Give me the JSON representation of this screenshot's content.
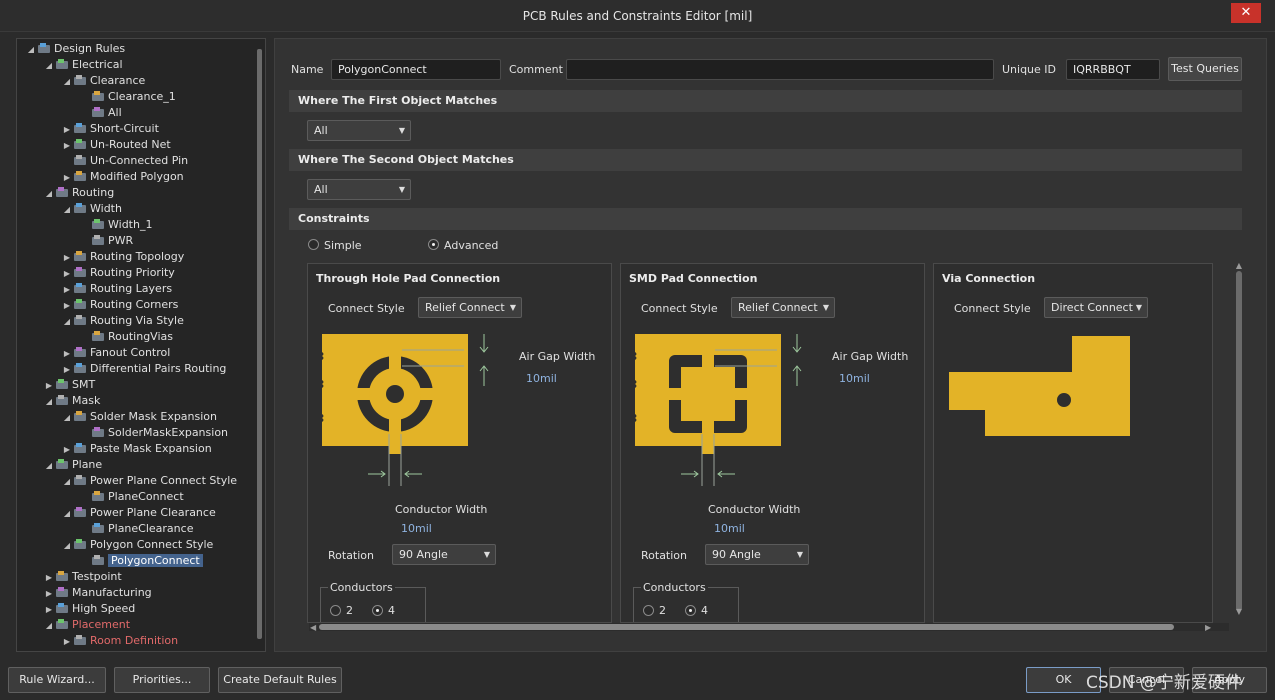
{
  "window": {
    "title": "PCB Rules and Constraints Editor [mil]",
    "close_glyph": "✕"
  },
  "tree": {
    "rows": [
      {
        "label": "Design Rules",
        "level": 0,
        "expander": "◢",
        "icon": "design-rules-icon"
      },
      {
        "label": "Electrical",
        "level": 1,
        "expander": "◢",
        "icon": "electrical-icon"
      },
      {
        "label": "Clearance",
        "level": 2,
        "expander": "◢",
        "icon": "clearance-icon"
      },
      {
        "label": "Clearance_1",
        "level": 3,
        "expander": "",
        "icon": "clearance-rule-icon"
      },
      {
        "label": "All",
        "level": 3,
        "expander": "",
        "icon": "clearance-rule-icon"
      },
      {
        "label": "Short-Circuit",
        "level": 2,
        "expander": "▶",
        "icon": "short-circuit-icon"
      },
      {
        "label": "Un-Routed Net",
        "level": 2,
        "expander": "▶",
        "icon": "unrouted-net-icon"
      },
      {
        "label": "Un-Connected Pin",
        "level": 2,
        "expander": "",
        "icon": "unconnected-pin-icon"
      },
      {
        "label": "Modified Polygon",
        "level": 2,
        "expander": "▶",
        "icon": "modified-polygon-icon"
      },
      {
        "label": "Routing",
        "level": 1,
        "expander": "◢",
        "icon": "routing-icon"
      },
      {
        "label": "Width",
        "level": 2,
        "expander": "◢",
        "icon": "width-icon"
      },
      {
        "label": "Width_1",
        "level": 3,
        "expander": "",
        "icon": "width-rule-icon"
      },
      {
        "label": "PWR",
        "level": 3,
        "expander": "",
        "icon": "width-rule-icon"
      },
      {
        "label": "Routing Topology",
        "level": 2,
        "expander": "▶",
        "icon": "routing-topology-icon"
      },
      {
        "label": "Routing Priority",
        "level": 2,
        "expander": "▶",
        "icon": "routing-priority-icon"
      },
      {
        "label": "Routing Layers",
        "level": 2,
        "expander": "▶",
        "icon": "routing-layers-icon"
      },
      {
        "label": "Routing Corners",
        "level": 2,
        "expander": "▶",
        "icon": "routing-corners-icon"
      },
      {
        "label": "Routing Via Style",
        "level": 2,
        "expander": "◢",
        "icon": "routing-via-style-icon"
      },
      {
        "label": "RoutingVias",
        "level": 3,
        "expander": "",
        "icon": "routing-via-rule-icon"
      },
      {
        "label": "Fanout Control",
        "level": 2,
        "expander": "▶",
        "icon": "fanout-control-icon"
      },
      {
        "label": "Differential Pairs Routing",
        "level": 2,
        "expander": "▶",
        "icon": "diff-pairs-icon"
      },
      {
        "label": "SMT",
        "level": 1,
        "expander": "▶",
        "icon": "smt-icon"
      },
      {
        "label": "Mask",
        "level": 1,
        "expander": "◢",
        "icon": "mask-icon"
      },
      {
        "label": "Solder Mask Expansion",
        "level": 2,
        "expander": "◢",
        "icon": "solder-mask-icon"
      },
      {
        "label": "SolderMaskExpansion",
        "level": 3,
        "expander": "",
        "icon": "solder-mask-rule-icon"
      },
      {
        "label": "Paste Mask Expansion",
        "level": 2,
        "expander": "▶",
        "icon": "paste-mask-icon"
      },
      {
        "label": "Plane",
        "level": 1,
        "expander": "◢",
        "icon": "plane-icon"
      },
      {
        "label": "Power Plane Connect Style",
        "level": 2,
        "expander": "◢",
        "icon": "plane-connect-icon"
      },
      {
        "label": "PlaneConnect",
        "level": 3,
        "expander": "",
        "icon": "plane-connect-rule-icon"
      },
      {
        "label": "Power Plane Clearance",
        "level": 2,
        "expander": "◢",
        "icon": "plane-clearance-icon"
      },
      {
        "label": "PlaneClearance",
        "level": 3,
        "expander": "",
        "icon": "plane-clearance-rule-icon"
      },
      {
        "label": "Polygon Connect Style",
        "level": 2,
        "expander": "◢",
        "icon": "polygon-connect-icon"
      },
      {
        "label": "PolygonConnect",
        "level": 3,
        "expander": "",
        "icon": "polygon-connect-rule-icon",
        "selected": true
      },
      {
        "label": "Testpoint",
        "level": 1,
        "expander": "▶",
        "icon": "testpoint-icon"
      },
      {
        "label": "Manufacturing",
        "level": 1,
        "expander": "▶",
        "icon": "manufacturing-icon"
      },
      {
        "label": "High Speed",
        "level": 1,
        "expander": "▶",
        "icon": "high-speed-icon"
      },
      {
        "label": "Placement",
        "level": 1,
        "expander": "◢",
        "icon": "placement-icon",
        "red": true
      },
      {
        "label": "Room Definition",
        "level": 2,
        "expander": "▶",
        "icon": "room-definition-icon",
        "red": true
      }
    ]
  },
  "header": {
    "name_label": "Name",
    "name_value": "PolygonConnect",
    "comment_label": "Comment",
    "comment_value": "",
    "uid_label": "Unique ID",
    "uid_value": "IQRRBBQT",
    "test_queries": "Test Queries"
  },
  "first_match": {
    "title": "Where The First Object Matches",
    "value": "All"
  },
  "second_match": {
    "title": "Where The Second Object Matches",
    "value": "All"
  },
  "constraints": {
    "title": "Constraints",
    "simple": "Simple",
    "advanced": "Advanced",
    "selected": "advanced"
  },
  "through_hole": {
    "title": "Through Hole Pad Connection",
    "connect_style_label": "Connect Style",
    "connect_style": "Relief Connect",
    "air_gap_label": "Air Gap Width",
    "air_gap_value": "10mil",
    "conductor_label": "Conductor Width",
    "conductor_value": "10mil",
    "rotation_label": "Rotation",
    "rotation_value": "90 Angle",
    "conductors_label": "Conductors",
    "opt2": "2",
    "opt4": "4",
    "conductors_selected": "4"
  },
  "smd": {
    "title": "SMD Pad Connection",
    "connect_style_label": "Connect Style",
    "connect_style": "Relief Connect",
    "air_gap_label": "Air Gap Width",
    "air_gap_value": "10mil",
    "conductor_label": "Conductor Width",
    "conductor_value": "10mil",
    "rotation_label": "Rotation",
    "rotation_value": "90 Angle",
    "conductors_label": "Conductors",
    "opt2": "2",
    "opt4": "4",
    "conductors_selected": "4"
  },
  "via": {
    "title": "Via Connection",
    "connect_style_label": "Connect Style",
    "connect_style": "Direct Connect"
  },
  "footer": {
    "rule_wizard": "Rule Wizard...",
    "priorities": "Priorities...",
    "create_default": "Create Default Rules",
    "ok": "OK",
    "cancel": "Cancel",
    "apply": "Apply"
  },
  "watermark": "CSDN @宁新爱硬件",
  "colors": {
    "copper": "#e3b327",
    "selection": "#44638d",
    "value_text": "#8fb3e0",
    "red_text": "#e26a6a"
  }
}
